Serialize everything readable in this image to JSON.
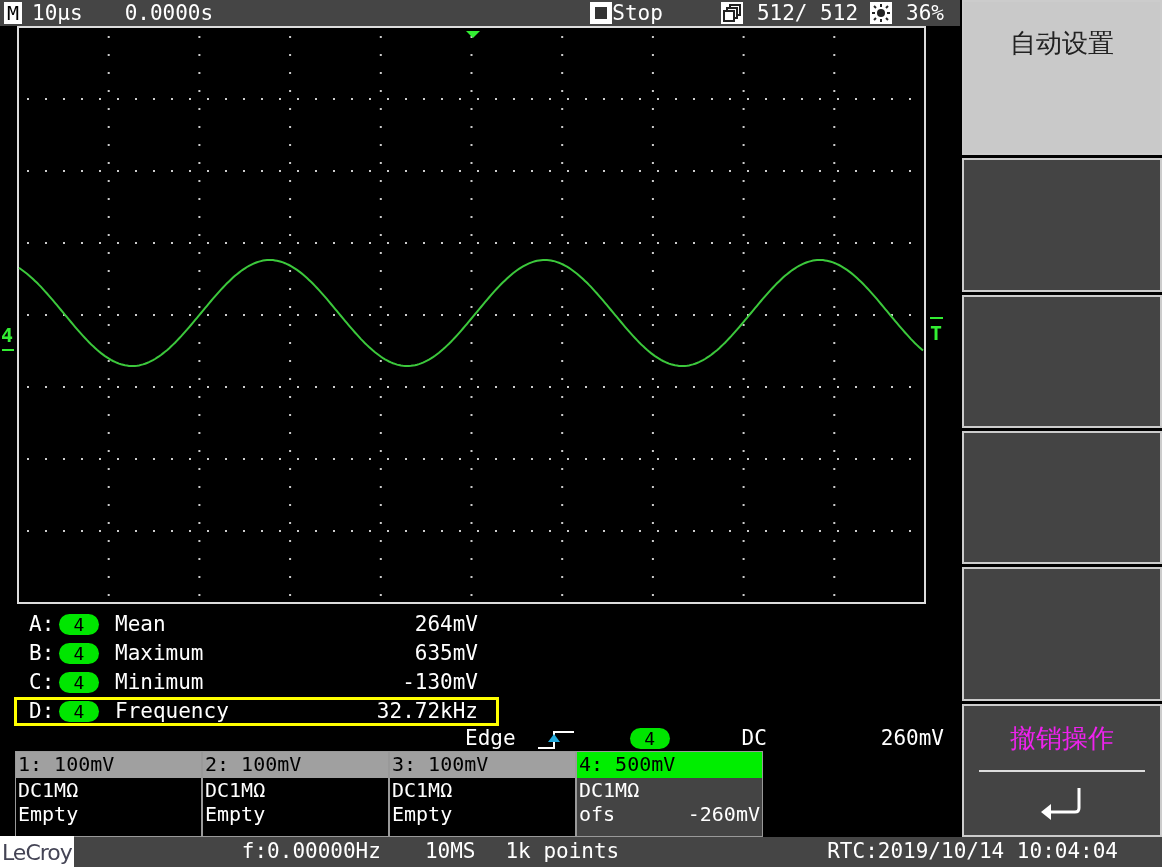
{
  "top_bar": {
    "mode": "M",
    "timebase": "10µs",
    "delay": "0.0000s",
    "run_state": "Stop",
    "acquisitions": "512/ 512",
    "brightness": "36%"
  },
  "scope": {
    "channel_marker": "4",
    "trigger_marker": "T"
  },
  "measurements": [
    {
      "slot": "A:",
      "channel": "4",
      "name": "Mean",
      "value": "264mV",
      "selected": false
    },
    {
      "slot": "B:",
      "channel": "4",
      "name": "Maximum",
      "value": "635mV",
      "selected": false
    },
    {
      "slot": "C:",
      "channel": "4",
      "name": "Minimum",
      "value": "-130mV",
      "selected": false
    },
    {
      "slot": "D:",
      "channel": "4",
      "name": "Frequency",
      "value": "32.72kHz",
      "selected": true
    }
  ],
  "trigger": {
    "type": "Edge",
    "channel": "4",
    "coupling": "DC",
    "level": "260mV"
  },
  "channels": [
    {
      "scale": "1: 100mV",
      "coupling": "DC1MΩ",
      "status": "Empty",
      "selected": false
    },
    {
      "scale": "2: 100mV",
      "coupling": "DC1MΩ",
      "status": "Empty",
      "selected": false
    },
    {
      "scale": "3: 100mV",
      "coupling": "DC1MΩ",
      "status": "Empty",
      "selected": false
    },
    {
      "scale": "4: 500mV",
      "coupling": "DC1MΩ",
      "status": "ofs",
      "offset": "-260mV",
      "selected": true
    }
  ],
  "softkeys": [
    {
      "kind": "light",
      "label": "自动设置"
    },
    {
      "kind": "blank"
    },
    {
      "kind": "blank"
    },
    {
      "kind": "blank"
    },
    {
      "kind": "blank"
    },
    {
      "kind": "return",
      "label": "撤销操作"
    }
  ],
  "status_bar": {
    "brand": "LeCroy",
    "frequency": "f:0.00000Hz",
    "sample_rate": "10MS",
    "record_length": "1k points",
    "clock": "RTC:2019/10/14 10:04:04"
  }
}
